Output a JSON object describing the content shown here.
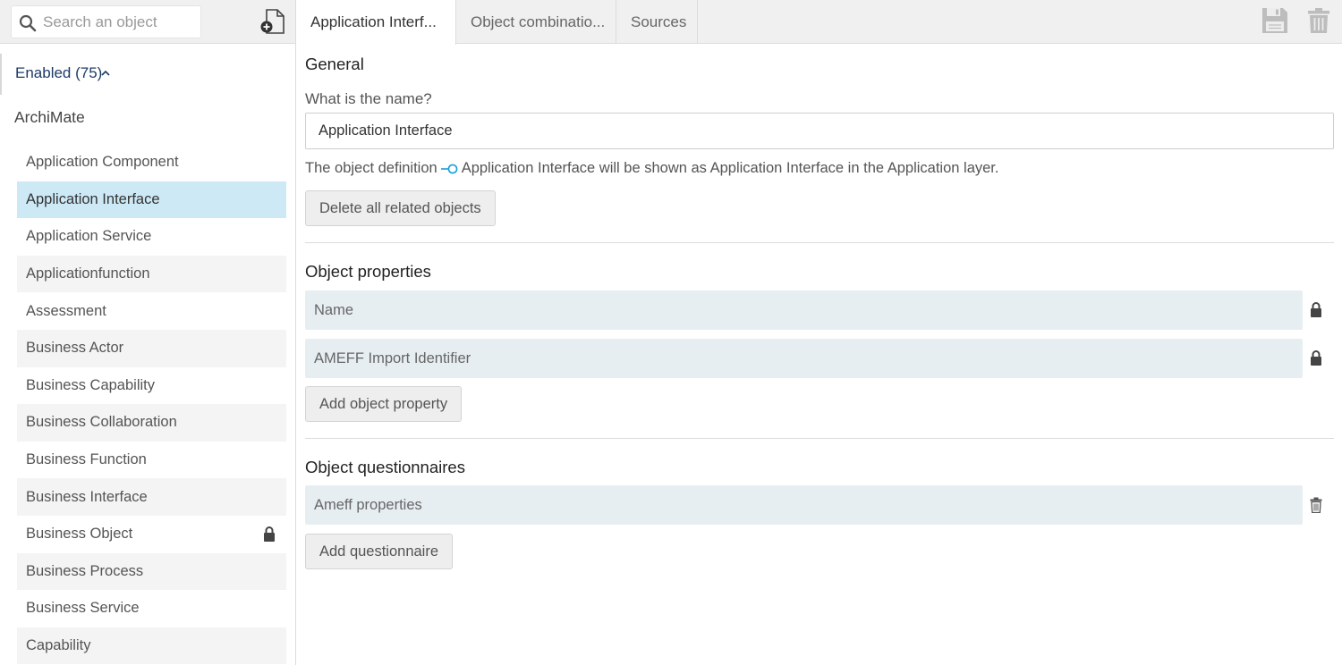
{
  "sidebar": {
    "search": {
      "placeholder": "Search an object"
    },
    "enabled_label": "Enabled (75)",
    "group_title": "ArchiMate",
    "items": [
      {
        "label": "Application Component",
        "selected": false,
        "locked": false
      },
      {
        "label": "Application Interface",
        "selected": true,
        "locked": false
      },
      {
        "label": "Application Service",
        "selected": false,
        "locked": false
      },
      {
        "label": "Applicationfunction",
        "selected": false,
        "locked": false
      },
      {
        "label": "Assessment",
        "selected": false,
        "locked": false
      },
      {
        "label": "Business Actor",
        "selected": false,
        "locked": false
      },
      {
        "label": "Business Capability",
        "selected": false,
        "locked": false
      },
      {
        "label": "Business Collaboration",
        "selected": false,
        "locked": false
      },
      {
        "label": "Business Function",
        "selected": false,
        "locked": false
      },
      {
        "label": "Business Interface",
        "selected": false,
        "locked": false
      },
      {
        "label": "Business Object",
        "selected": false,
        "locked": true
      },
      {
        "label": "Business Process",
        "selected": false,
        "locked": false
      },
      {
        "label": "Business Service",
        "selected": false,
        "locked": false
      },
      {
        "label": "Capability",
        "selected": false,
        "locked": false
      }
    ]
  },
  "tabs": [
    {
      "label": "Application Interf...",
      "active": true
    },
    {
      "label": "Object combinatio...",
      "active": false
    },
    {
      "label": "Sources",
      "active": false
    }
  ],
  "general": {
    "title": "General",
    "name_question": "What is the name?",
    "name_value": "Application Interface",
    "definition_prefix": "The object definition",
    "definition_suffix": "Application Interface will be shown as Application Interface in the Application layer.",
    "delete_related_label": "Delete all related objects"
  },
  "properties": {
    "title": "Object properties",
    "items": [
      {
        "label": "Name",
        "icon": "lock-icon"
      },
      {
        "label": "AMEFF Import Identifier",
        "icon": "lock-icon"
      }
    ],
    "add_label": "Add object property"
  },
  "questionnaires": {
    "title": "Object questionnaires",
    "items": [
      {
        "label": "Ameff properties",
        "icon": "trash-icon"
      }
    ],
    "add_label": "Add questionnaire"
  },
  "colors": {
    "selected_bg": "#cde9f6",
    "row_bg": "#e7eef2",
    "accent": "#1a9fd6",
    "header_text": "#1c3a66"
  }
}
